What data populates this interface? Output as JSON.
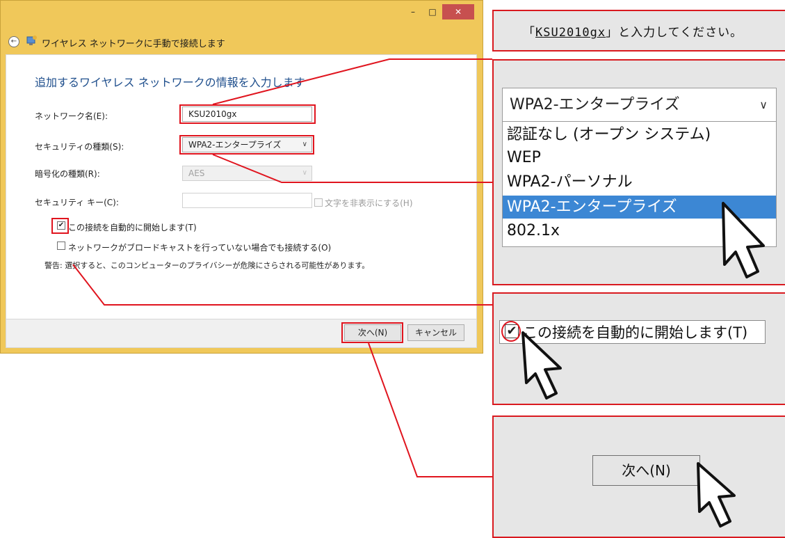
{
  "dialog": {
    "caption": "ワイヤレス ネットワークに手動で接続します",
    "heading": "追加するワイヤレス ネットワークの情報を入力します",
    "window_buttons": {
      "minimize": "–",
      "maximize": "□",
      "close": "✕"
    },
    "fields": {
      "network_name_label": "ネットワーク名(E):",
      "network_name_value": "KSU2010gx",
      "security_label": "セキュリティの種類(S):",
      "security_value": "WPA2-エンタープライズ",
      "encryption_label": "暗号化の種類(R):",
      "encryption_value": "AES",
      "key_label": "セキュリティ キー(C):",
      "hide_chars_label": "文字を非表示にする(H)"
    },
    "auto_connect_label": "この接続を自動的に開始します(T)",
    "broadcast_label": "ネットワークがブロードキャストを行っていない場合でも接続する(O)",
    "warning": "警告: 選択すると、このコンピューターのプライバシーが危険にさらされる可能性があります。",
    "next_button": "次へ(N)",
    "cancel_button": "キャンセル"
  },
  "callouts": {
    "instruction_pre": "「",
    "instruction_name": "KSU2010gx",
    "instruction_post": "」と入力してください。",
    "dropdown_selected": "WPA2-エンタープライズ",
    "dropdown_options": [
      "認証なし (オープン システム)",
      "WEP",
      "WPA2-パーソナル",
      "WPA2-エンタープライズ",
      "802.1x"
    ],
    "checkbox_label": "この接続を自動的に開始します(T)",
    "next_button": "次へ(N)"
  },
  "colors": {
    "annotation_red": "#e0141e",
    "selection_blue": "#3c87d4",
    "window_frame": "#f0c85a",
    "heading_blue": "#1e4e8c"
  },
  "icons": [
    "back-arrow-icon",
    "wireless-network-icon",
    "checkmark-icon",
    "chevron-down-icon",
    "mouse-pointer-icon"
  ]
}
